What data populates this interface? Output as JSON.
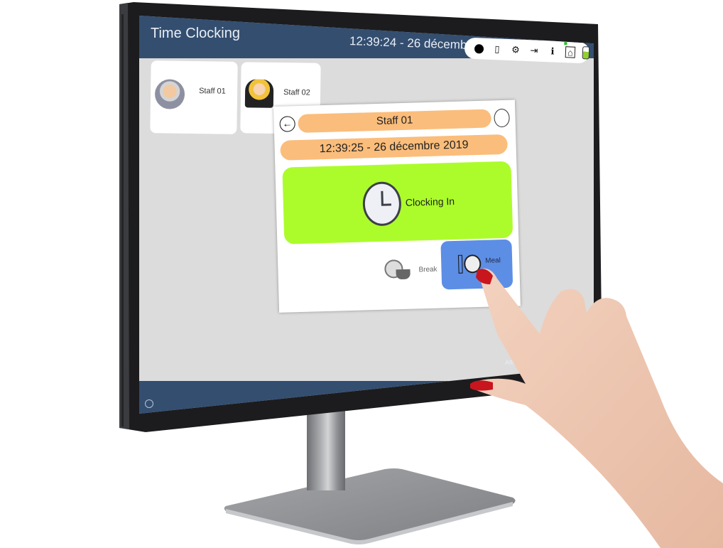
{
  "header": {
    "app_title": "Time Clocking",
    "datetime": "12:39:24 - 26 décembre 2019",
    "icons": [
      "status-dot-icon",
      "notebook-icon",
      "gear-icon",
      "logout-icon",
      "info-icon",
      "network-icon",
      "battery-icon"
    ],
    "network_status_color": "#22c122",
    "battery_color": "#8fd22a"
  },
  "staff": [
    {
      "name": "Staff 01"
    },
    {
      "name": "Staff 02"
    }
  ],
  "dialog": {
    "back_symbol": "←",
    "staff_name": "Staff 01",
    "datetime": "12:39:25 - 26 décembre 2019",
    "clock_in_label": "Clocking In",
    "break_label": "Break",
    "meal_label": "Meal"
  },
  "footer": {
    "warning_text": "Attention, Software S"
  },
  "colors": {
    "topbar": "#344e70",
    "pill": "#fbbd7b",
    "clock_in": "#acfc2c",
    "meal": "#5d8ee6",
    "screen_bg": "#dcdcdc"
  }
}
